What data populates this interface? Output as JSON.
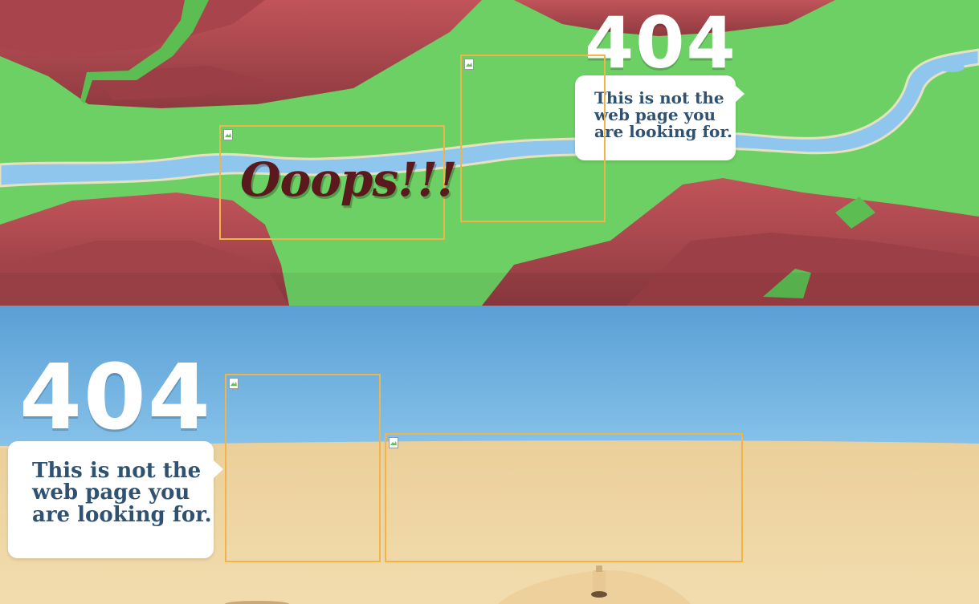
{
  "top_scene": {
    "code": "404",
    "message": "This is not the\nweb page you\nare looking for.",
    "ooops": "Ooops!!!"
  },
  "bottom_scene": {
    "code": "404",
    "message": "This is not the\nweb page you\nare looking for."
  },
  "colors": {
    "grass": "#6dd064",
    "rock": "#b2484f",
    "river": "#8ec6ee",
    "sky": "#6fb6e6",
    "sand": "#f1d7a4",
    "bubble_text": "#2f5272",
    "frame": "#f0b54a"
  },
  "icons": [
    "broken-image-icon"
  ]
}
